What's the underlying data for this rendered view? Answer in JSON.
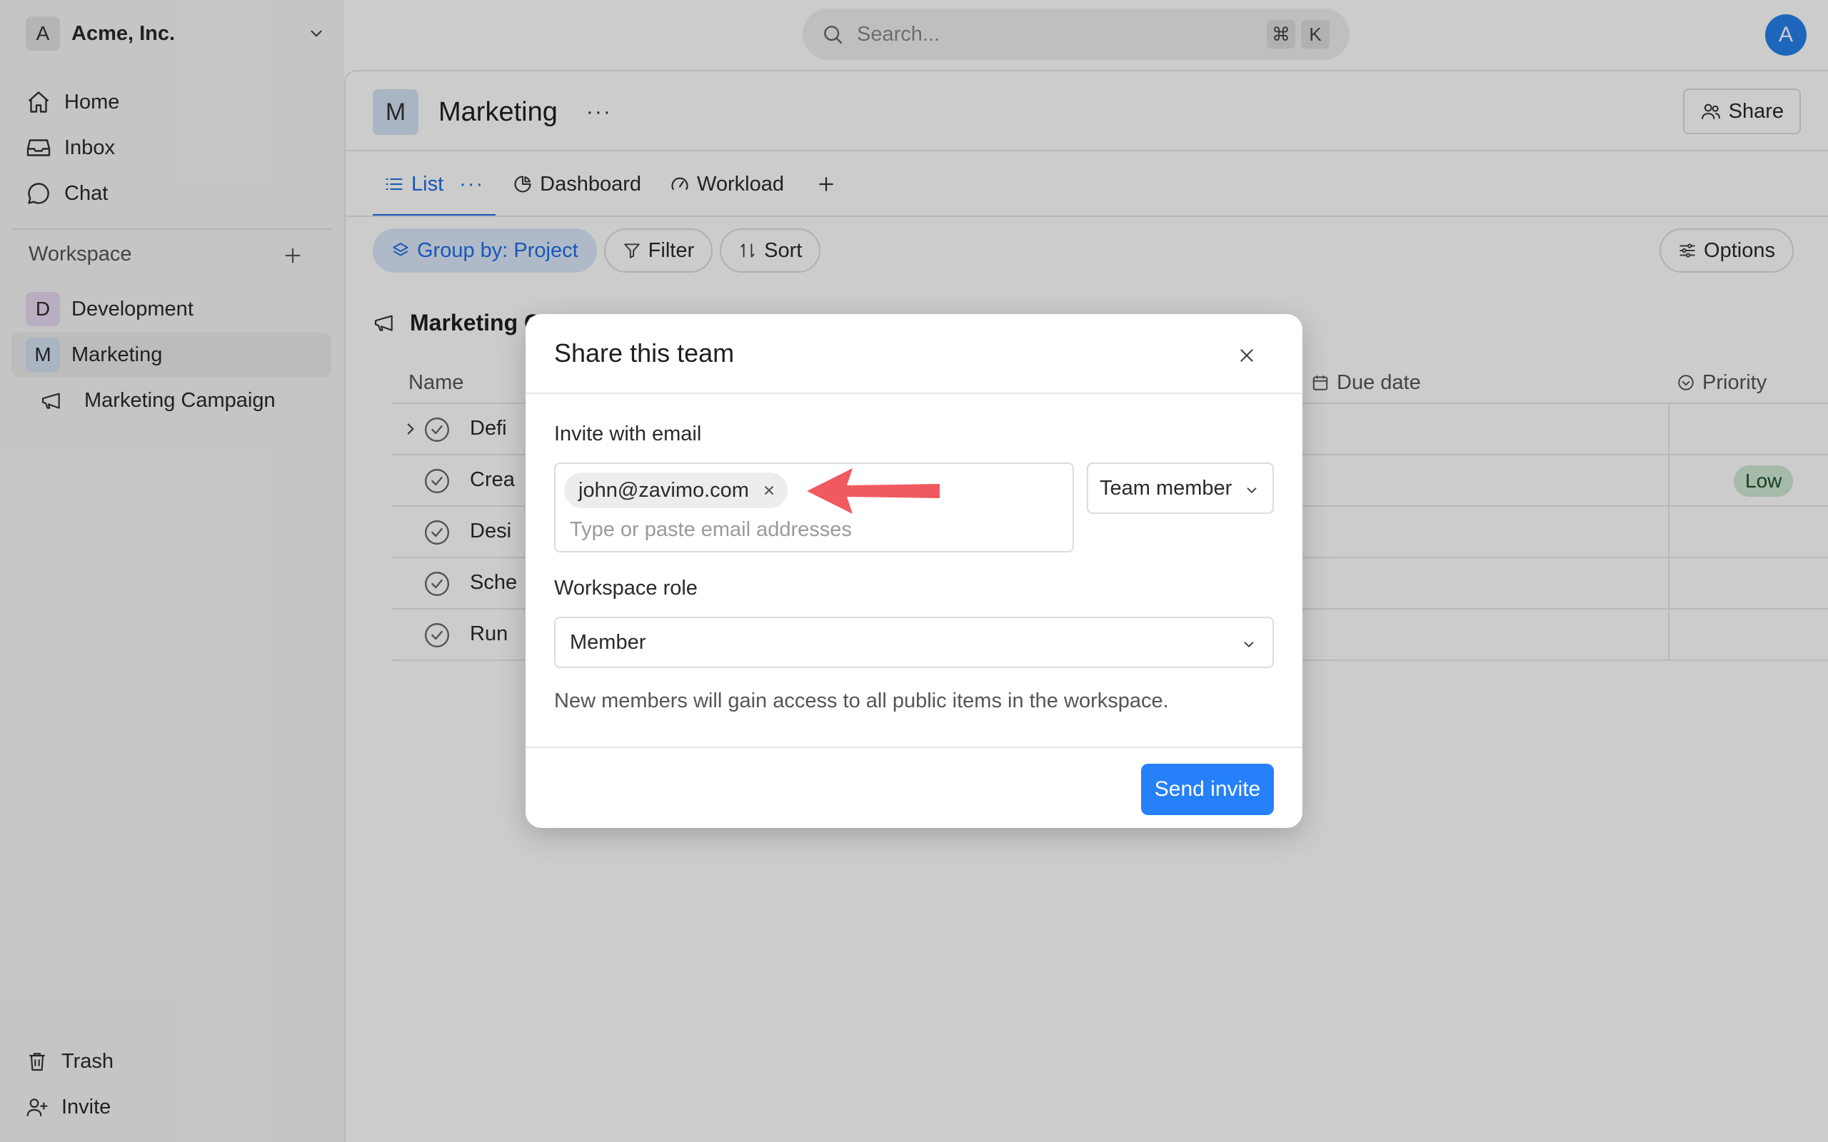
{
  "workspace_switcher": {
    "avatar": "A",
    "name": "Acme, Inc."
  },
  "sidebar": {
    "nav": [
      {
        "label": "Home",
        "icon": "home-icon"
      },
      {
        "label": "Inbox",
        "icon": "inbox-icon"
      },
      {
        "label": "Chat",
        "icon": "chat-icon"
      }
    ],
    "workspace_heading": "Workspace",
    "teams": [
      {
        "badge": "D",
        "label": "Development",
        "badge_color": "#e8d9f2"
      },
      {
        "badge": "M",
        "label": "Marketing",
        "badge_color": "#d5e3f6",
        "active": true
      }
    ],
    "project": {
      "label": "Marketing Campaign",
      "icon": "megaphone-icon"
    },
    "footer": [
      {
        "label": "Trash",
        "icon": "trash-icon"
      },
      {
        "label": "Invite",
        "icon": "invite-user-icon"
      }
    ]
  },
  "topbar": {
    "search_placeholder": "Search...",
    "shortcut_keys": [
      "⌘",
      "K"
    ],
    "user_avatar": "A"
  },
  "team_header": {
    "badge": "M",
    "title": "Marketing",
    "more": "···",
    "share_label": "Share"
  },
  "tabs": [
    {
      "label": "List",
      "icon": "list-icon",
      "active": true,
      "more": "···"
    },
    {
      "label": "Dashboard",
      "icon": "pie-chart-icon"
    },
    {
      "label": "Workload",
      "icon": "gauge-icon"
    }
  ],
  "toolbar": {
    "group_by": "Group by: Project",
    "filter": "Filter",
    "sort": "Sort",
    "options": "Options"
  },
  "group": {
    "title_visible": "Marketing C"
  },
  "table": {
    "columns": {
      "name": "Name",
      "due_date": "Due date",
      "priority": "Priority"
    },
    "rows": [
      {
        "name": "Defi",
        "expandable": true,
        "priority": ""
      },
      {
        "name": "Crea",
        "priority": "Low"
      },
      {
        "name": "Desi",
        "priority": ""
      },
      {
        "name": "Sche",
        "priority": ""
      },
      {
        "name": "Run",
        "priority": ""
      }
    ]
  },
  "modal": {
    "title": "Share this team",
    "invite_label": "Invite with email",
    "email_chip": "john@zavimo.com",
    "email_placeholder": "Type or paste email addresses",
    "team_role": "Team member",
    "workspace_role_label": "Workspace role",
    "workspace_role": "Member",
    "help_text": "New members will gain access to all public items in the workspace.",
    "send_label": "Send invite"
  },
  "colors": {
    "accent": "#1f6fe5",
    "send_button": "#2680fa",
    "priority_low_bg": "#cfe9d4",
    "callout_arrow": "#f0595f"
  }
}
